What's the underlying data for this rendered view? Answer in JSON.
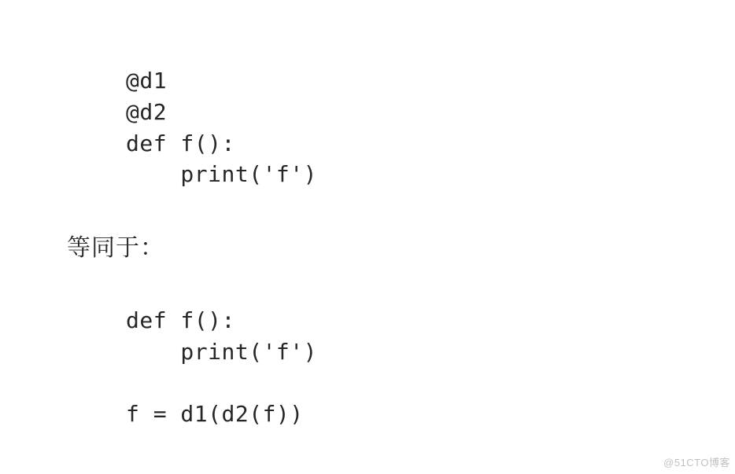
{
  "code_top": {
    "lines": [
      "@d1",
      "@d2",
      "def f():",
      "    print('f')"
    ]
  },
  "prose": {
    "text": "等同于："
  },
  "code_bottom": {
    "lines": [
      "def f():",
      "    print('f')",
      "",
      "f = d1(d2(f))"
    ]
  },
  "watermark": {
    "text": "@51CTO博客"
  }
}
